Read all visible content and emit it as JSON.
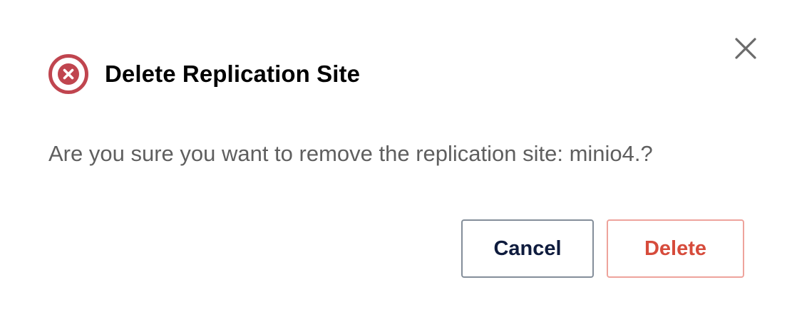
{
  "dialog": {
    "title": "Delete Replication Site",
    "message": "Are you sure you want to remove the replication site: minio4.?",
    "cancel_label": "Cancel",
    "delete_label": "Delete",
    "icons": {
      "header": "error-circle-icon",
      "close": "close-icon"
    },
    "colors": {
      "error_icon": "#c0454f",
      "delete_text": "#d64b3b",
      "delete_border": "#eea39c",
      "cancel_text": "#0e1b3d",
      "cancel_border": "#848e9a",
      "message_text": "#5f5f5f"
    }
  }
}
